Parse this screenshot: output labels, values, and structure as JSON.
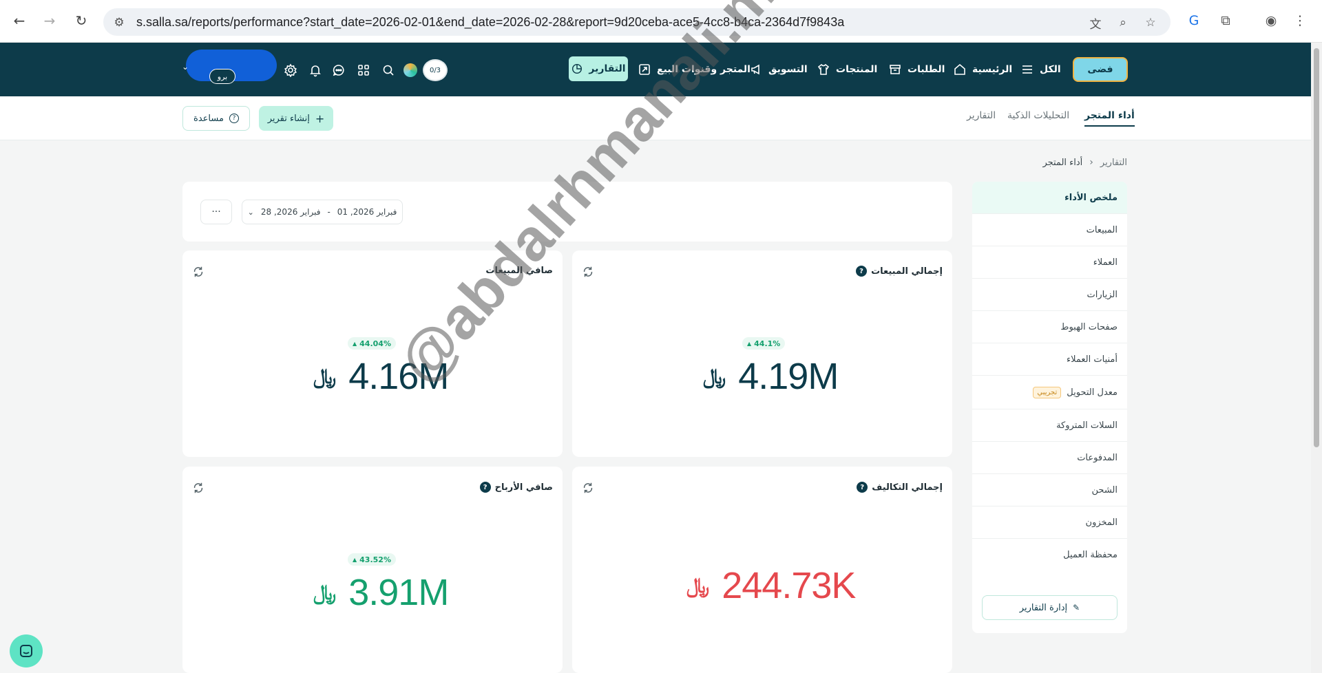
{
  "browser": {
    "url": "s.salla.sa/reports/performance?start_date=2026-02-01&end_date=2026-02-28&report=9d20ceba-ace5-4cc8-b4ca-2364d7f9843a"
  },
  "topnav": {
    "logo_text": "فضى",
    "items": [
      {
        "label": "الكل",
        "icon": "menu-icon"
      },
      {
        "label": "الرئيسية",
        "icon": "home-icon"
      },
      {
        "label": "الطلبات",
        "icon": "archive-icon"
      },
      {
        "label": "المنتجات",
        "icon": "shirt-icon"
      },
      {
        "label": "التسويق",
        "icon": "megaphone-icon"
      },
      {
        "label": "المتجر وقنوات البيع",
        "icon": "store-icon"
      }
    ],
    "active_item": {
      "label": "التقارير",
      "icon": "pie-chart-icon"
    },
    "progress_counter": "0/3",
    "plan_badge": "برو"
  },
  "tabs": {
    "items": [
      {
        "label": "أداء المتجر",
        "active": true
      },
      {
        "label": "التحليلات الذكية",
        "active": false
      },
      {
        "label": "التقارير",
        "active": false
      }
    ],
    "create_report": "إنشاء تقرير",
    "help": "مساعدة"
  },
  "breadcrumb": {
    "root": "التقارير",
    "current": "أداء المتجر"
  },
  "sidebar": {
    "items": [
      {
        "label": "ملخص الأداء",
        "active": true
      },
      {
        "label": "المبيعات"
      },
      {
        "label": "العملاء"
      },
      {
        "label": "الزيارات"
      },
      {
        "label": "صفحات الهبوط"
      },
      {
        "label": "أمنيات العملاء"
      },
      {
        "label": "معدل التحويل",
        "badge": "تجريبي"
      },
      {
        "label": "السلات المتروكة"
      },
      {
        "label": "المدفوعات"
      },
      {
        "label": "الشحن"
      },
      {
        "label": "المخزون"
      },
      {
        "label": "محفظة العميل"
      }
    ],
    "manage_reports": "إدارة التقارير"
  },
  "filters": {
    "date_start": "فبراير 2026, 01",
    "separator": "-",
    "date_end": "فبراير 2026, 28",
    "more": "···"
  },
  "metrics": {
    "total_sales": {
      "title": "إجمالي المبيعات",
      "value": "4.19M",
      "change": "44.1%",
      "currency": "﷼",
      "color": "#0d3b4a"
    },
    "net_sales": {
      "title": "صافي المبيعات",
      "value": "4.16M",
      "change": "44.04%",
      "currency": "﷼",
      "color": "#0d3b4a"
    },
    "total_costs": {
      "title": "إجمالي التكاليف",
      "value": "244.73K",
      "currency": "﷼",
      "color": "#e5484d"
    },
    "net_profit": {
      "title": "صافي الأرباح",
      "value": "3.91M",
      "change": "43.52%",
      "currency": "﷼",
      "color": "#15a06e"
    }
  },
  "watermark": "@abdalrhmanali.marketing"
}
